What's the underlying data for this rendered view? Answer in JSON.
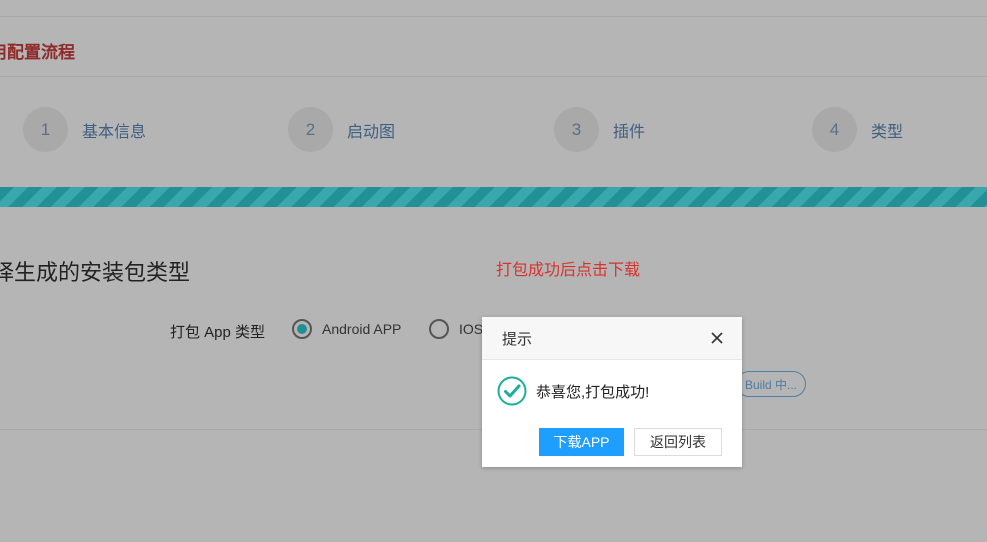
{
  "section_title": "用配置流程",
  "steps": [
    {
      "number": "1",
      "label": "基本信息"
    },
    {
      "number": "2",
      "label": "启动图"
    },
    {
      "number": "3",
      "label": "插件"
    },
    {
      "number": "4",
      "label": "类型"
    }
  ],
  "type_heading": "择生成的安装包类型",
  "hint": "打包成功后点击下载",
  "form": {
    "label": "打包 App 类型",
    "options": [
      {
        "label": "Android APP",
        "selected": true
      },
      {
        "label": "IOS",
        "selected": false
      }
    ],
    "build_button": "Build 中..."
  },
  "modal": {
    "title": "提示",
    "message": "恭喜您,打包成功!",
    "primary_button": "下载APP",
    "secondary_button": "返回列表"
  },
  "colors": {
    "accent": "#1e9fff",
    "success": "#1aaf9b",
    "hint": "#d7332c",
    "progress": "#238f96"
  }
}
